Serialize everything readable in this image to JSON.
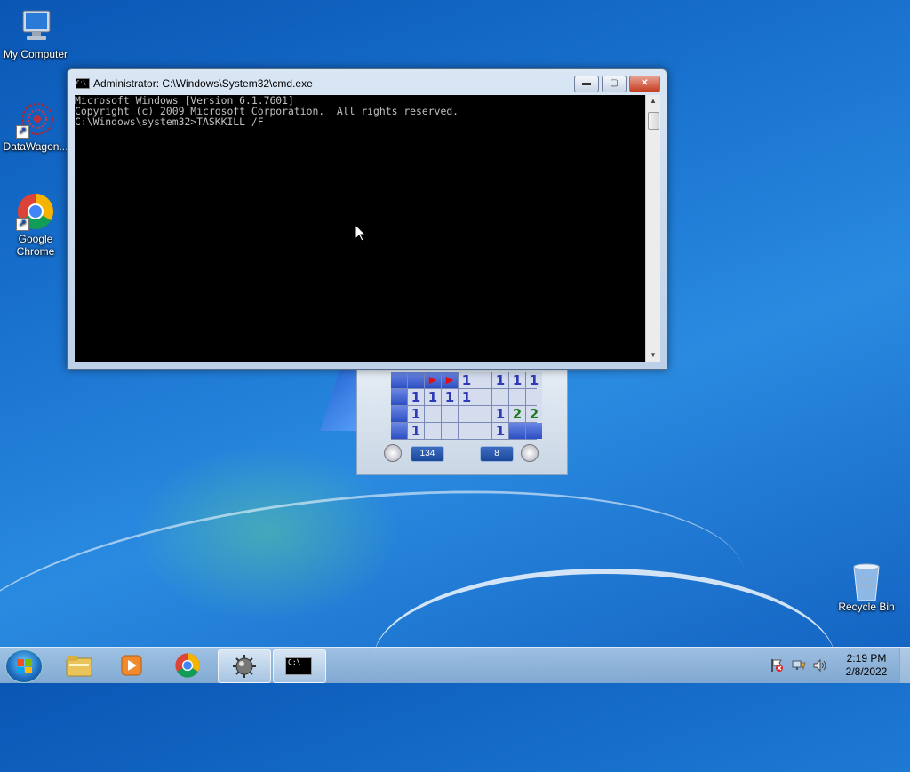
{
  "desktop": {
    "icons": [
      {
        "label": "My Computer"
      },
      {
        "label": "DataWagon..."
      },
      {
        "label": "Google Chrome"
      },
      {
        "label": "Recycle Bin"
      }
    ]
  },
  "cmd_window": {
    "title": "Administrator: C:\\Windows\\System32\\cmd.exe",
    "icon_text": "C:\\",
    "lines": [
      "Microsoft Windows [Version 6.1.7601]",
      "Copyright (c) 2009 Microsoft Corporation.  All rights reserved.",
      "",
      "C:\\Windows\\system32>TASKKILL /F"
    ],
    "minimize_label": "▬",
    "maximize_label": "▢",
    "close_label": "✕"
  },
  "minesweeper": {
    "time": "134",
    "mines_left": "8",
    "grid": [
      [
        "C",
        "C",
        "F",
        "F",
        "1",
        "",
        "1",
        "1",
        "1"
      ],
      [
        "C",
        "1",
        "1",
        "1",
        "1",
        "",
        "",
        "",
        ""
      ],
      [
        "C",
        "1",
        "",
        "",
        "",
        "",
        "1",
        "2",
        "2"
      ],
      [
        "C",
        "1",
        "",
        "",
        "",
        "",
        "1",
        "C",
        "C"
      ]
    ]
  },
  "taskbar": {
    "clock_time": "2:19 PM",
    "clock_date": "2/8/2022",
    "items": [
      "Start",
      "Windows Explorer",
      "Windows Media Player",
      "Google Chrome",
      "Minesweeper",
      "Command Prompt"
    ]
  }
}
